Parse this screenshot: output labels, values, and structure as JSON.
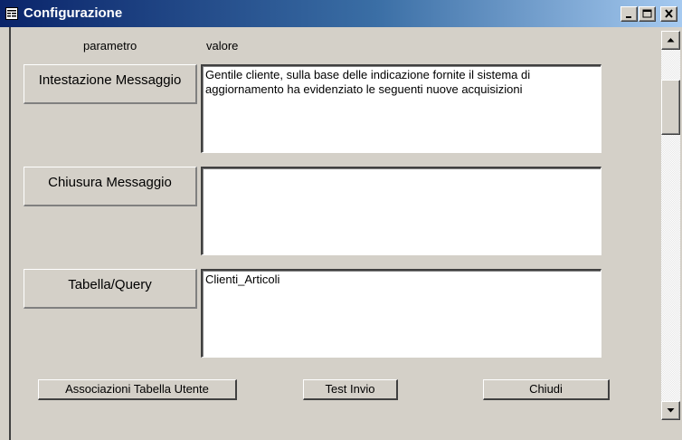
{
  "window": {
    "title": "Configurazione",
    "icon": "form-icon",
    "controls": [
      "minimize-icon",
      "maximize-icon",
      "close-icon"
    ]
  },
  "headers": {
    "param": "parametro",
    "value": "valore"
  },
  "rows": [
    {
      "label": "Intestazione Messaggio",
      "value": "Gentile cliente, sulla base delle indicazione fornite il sistema di aggiornamento ha evidenziato le seguenti nuove acquisizioni"
    },
    {
      "label": "Chiusura Messaggio",
      "value": ""
    },
    {
      "label": "Tabella/Query",
      "value": "Clienti_Articoli"
    }
  ],
  "buttons": {
    "associations": "Associazioni Tabella Utente",
    "test_send": "Test Invio",
    "close": "Chiudi"
  },
  "scrollbar": {
    "up_icon": "arrow-up-icon",
    "down_icon": "arrow-down-icon"
  }
}
